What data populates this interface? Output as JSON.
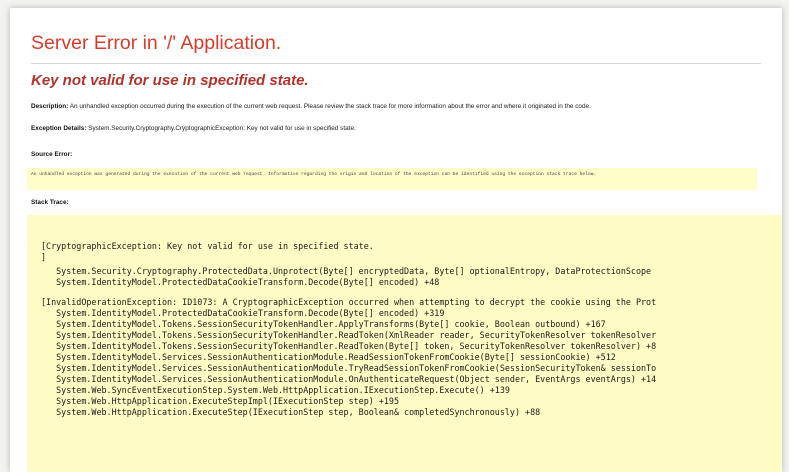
{
  "page": {
    "title": "Server Error in '/' Application.",
    "subtitle": "Key not valid for use in specified state."
  },
  "description": {
    "label": "Description:",
    "text": "An unhandled exception occurred during the execution of the current web request. Please review the stack trace for more information about the error and where it originated in the code."
  },
  "exception_details": {
    "label": "Exception Details:",
    "text": "System.Security.Cryptography.CryptographicException: Key not valid for use in specified state."
  },
  "source_error": {
    "label": "Source Error:",
    "text": "An unhandled exception was generated during the execution of the current web request. Information regarding the origin and location of the exception can be identified using the exception stack trace below."
  },
  "stack_trace": {
    "label": "Stack Trace:",
    "lines": [
      "[CryptographicException: Key not valid for use in specified state.",
      "]",
      "   System.Security.Cryptography.ProtectedData.Unprotect(Byte[] encryptedData, Byte[] optionalEntropy, DataProtectionScope",
      "   System.IdentityModel.ProtectedDataCookieTransform.Decode(Byte[] encoded) +48",
      "",
      "[InvalidOperationException: ID1073: A CryptographicException occurred when attempting to decrypt the cookie using the Prot",
      "   System.IdentityModel.ProtectedDataCookieTransform.Decode(Byte[] encoded) +319",
      "   System.IdentityModel.Tokens.SessionSecurityTokenHandler.ApplyTransforms(Byte[] cookie, Boolean outbound) +167",
      "   System.IdentityModel.Tokens.SessionSecurityTokenHandler.ReadToken(XmlReader reader, SecurityTokenResolver tokenResolver",
      "   System.IdentityModel.Tokens.SessionSecurityTokenHandler.ReadToken(Byte[] token, SecurityTokenResolver tokenResolver) +8",
      "   System.IdentityModel.Services.SessionAuthenticationModule.ReadSessionTokenFromCookie(Byte[] sessionCookie) +512",
      "   System.IdentityModel.Services.SessionAuthenticationModule.TryReadSessionTokenFromCookie(SessionSecurityToken& sessionTo",
      "   System.IdentityModel.Services.SessionAuthenticationModule.OnAuthenticateRequest(Object sender, EventArgs eventArgs) +14",
      "   System.Web.SyncEventExecutionStep.System.Web.HttpApplication.IExecutionStep.Execute() +139",
      "   System.Web.HttpApplication.ExecuteStepImpl(IExecutionStep step) +195",
      "   System.Web.HttpApplication.ExecuteStep(IExecutionStep step, Boolean& completedSynchronously) +88"
    ]
  },
  "colors": {
    "title": "#d93b2b",
    "subtitle": "#b0342a",
    "code_background": "#fefcc4"
  }
}
